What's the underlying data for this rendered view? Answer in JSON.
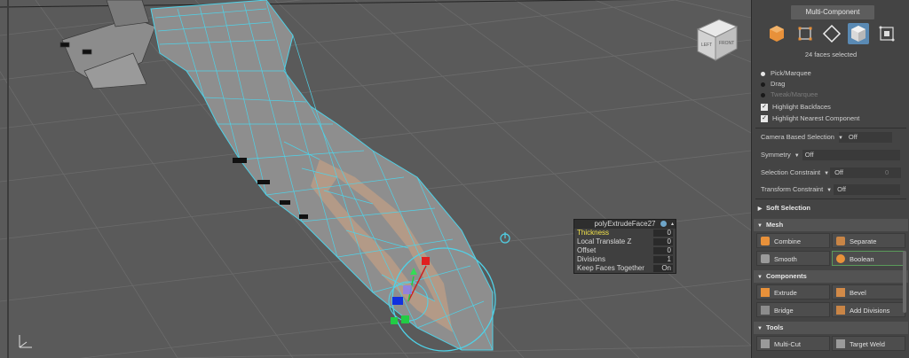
{
  "hud": {
    "title": "polyExtrudeFace27",
    "rows": [
      {
        "label": "Thickness",
        "value": "0",
        "highlight": true
      },
      {
        "label": "Local Translate Z",
        "value": "0"
      },
      {
        "label": "Offset",
        "value": "0"
      },
      {
        "label": "Divisions",
        "value": "1"
      },
      {
        "label": "Keep Faces Together",
        "value": "On"
      }
    ]
  },
  "viewcube": {
    "left": "LEFT",
    "front": "FRONT"
  },
  "panel": {
    "mode_button": "Multi-Component",
    "selection_count": "24 faces selected",
    "pick_marquee": "Pick/Marquee",
    "drag": "Drag",
    "tweak_marquee": "Tweak/Marquee",
    "highlight_backfaces": "Highlight Backfaces",
    "highlight_nearest": "Highlight Nearest Component",
    "camera_based": {
      "label": "Camera Based Selection",
      "value": "Off"
    },
    "symmetry": {
      "label": "Symmetry",
      "value": "Off"
    },
    "selection_constraint": {
      "label": "Selection Constraint",
      "value": "Off",
      "number": "0"
    },
    "transform_constraint": {
      "label": "Transform Constraint",
      "value": "Off"
    },
    "soft_selection": "Soft Selection",
    "mesh": {
      "title": "Mesh",
      "combine": "Combine",
      "separate": "Separate",
      "smooth": "Smooth",
      "boolean": "Boolean"
    },
    "components": {
      "title": "Components",
      "extrude": "Extrude",
      "bevel": "Bevel",
      "bridge": "Bridge",
      "add_divisions": "Add Divisions"
    },
    "tools": {
      "title": "Tools",
      "multi_cut": "Multi-Cut",
      "target_weld": "Target Weld"
    }
  },
  "colors": {
    "wire": "#4fd2e8",
    "selected_face": "#c9a78d",
    "highlight_text": "#f2e24a",
    "select_blue": "#5a8ab4",
    "accent_orange": "#e8913a"
  }
}
